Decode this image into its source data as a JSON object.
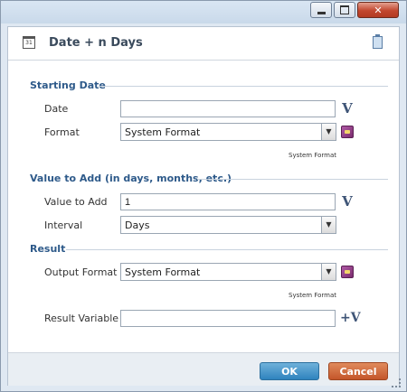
{
  "window": {
    "minimize": "–",
    "maximize": "□",
    "close": "✕"
  },
  "dialog": {
    "title": "Date + n Days",
    "calendar_icon_text": "31"
  },
  "starting_date": {
    "section_label": "Starting Date",
    "date_label": "Date",
    "date_value": "",
    "format_label": "Format",
    "format_value": "System Format",
    "format_hint": "System Format"
  },
  "value_to_add": {
    "section_label": "Value to Add (in days, months, etc.)",
    "value_label": "Value to Add",
    "value_value": "1",
    "interval_label": "Interval",
    "interval_value": "Days"
  },
  "result": {
    "section_label": "Result",
    "output_format_label": "Output Format",
    "output_format_value": "System Format",
    "output_format_hint": "System Format",
    "result_variable_label": "Result Variable",
    "result_variable_value": ""
  },
  "variable_button": "V",
  "new_variable_button": "+V",
  "footer": {
    "ok": "OK",
    "cancel": "Cancel"
  }
}
